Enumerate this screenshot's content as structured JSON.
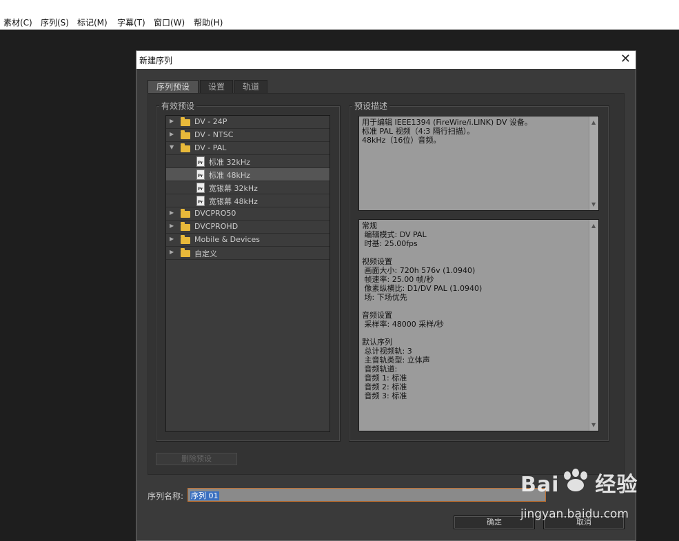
{
  "menubar": {
    "items": [
      "素材(C)",
      "序列(S)",
      "标记(M)",
      "字幕(T)",
      "窗口(W)",
      "帮助(H)"
    ]
  },
  "dialog": {
    "title": "新建序列",
    "tabs": [
      "序列预设",
      "设置",
      "轨道"
    ],
    "available_presets_label": "有效预设",
    "preset_description_label": "预设描述",
    "tree": [
      {
        "label": "DV - 24P",
        "expanded": false,
        "type": "folder"
      },
      {
        "label": "DV - NTSC",
        "expanded": false,
        "type": "folder"
      },
      {
        "label": "DV - PAL",
        "expanded": true,
        "type": "folder"
      },
      {
        "label": "标准 32kHz",
        "type": "preset"
      },
      {
        "label": "标准 48kHz",
        "type": "preset",
        "selected": true
      },
      {
        "label": "宽银幕 32kHz",
        "type": "preset"
      },
      {
        "label": "宽银幕 48kHz",
        "type": "preset"
      },
      {
        "label": "DVCPRO50",
        "expanded": false,
        "type": "folder"
      },
      {
        "label": "DVCPROHD",
        "expanded": false,
        "type": "folder"
      },
      {
        "label": "Mobile & Devices",
        "expanded": false,
        "type": "folder"
      },
      {
        "label": "自定义",
        "expanded": false,
        "type": "folder"
      }
    ],
    "description_text": "用于编辑 IEEE1394 (FireWire/i.LINK) DV 设备。\n标准 PAL 视频（4:3 隔行扫描）。\n48kHz（16位）音频。",
    "details_text": "常规\n 编辑模式: DV PAL\n 时基: 25.00fps\n\n视频设置\n 画面大小: 720h 576v (1.0940)\n 帧速率: 25.00 帧/秒\n 像素纵横比: D1/DV PAL (1.0940)\n 场: 下场优先\n\n音频设置\n 采样率: 48000 采样/秒\n\n默认序列\n 总计视频轨: 3\n 主音轨类型: 立体声\n 音频轨道:\n 音频 1: 标准\n 音频 2: 标准\n 音频 3: 标准",
    "delete_preset_label": "删除预设",
    "sequence_name_label": "序列名称:",
    "sequence_name_value": "序列 01",
    "ok_label": "确定",
    "cancel_label": "取消"
  },
  "watermark": {
    "brand": "Bai",
    "brand_suffix": "经验",
    "url": "jingyan.baidu.com"
  },
  "colors": {
    "folder": "#e8b93a",
    "selection": "#3a6fc0",
    "input_border": "#c07030"
  }
}
